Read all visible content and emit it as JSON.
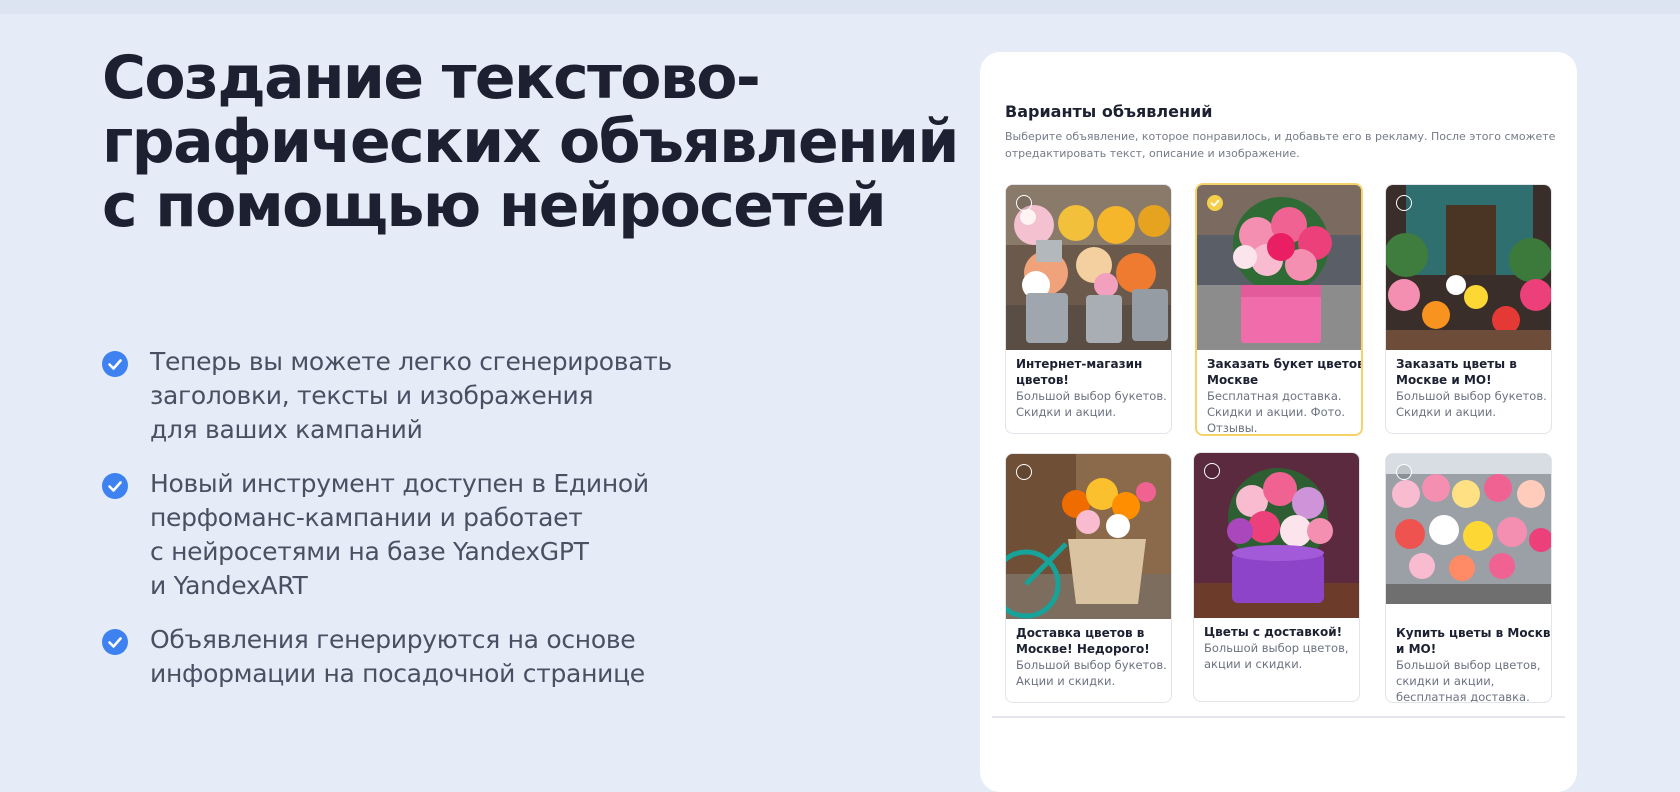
{
  "headline": {
    "lines": [
      "Создание текстово-",
      "графических объявлений",
      "с помощью нейросетей"
    ]
  },
  "bullets": [
    {
      "icon": "check-circle-icon",
      "lines": [
        "Теперь вы можете легко сгенерировать",
        "заголовки, тексты и изображения",
        "для ваших кампаний"
      ]
    },
    {
      "icon": "check-circle-icon",
      "lines": [
        "Новый инструмент доступен в Единой",
        "перфоманс-кампании и работает",
        "с нейросетями на базе YandexGPT",
        "и YandexART"
      ]
    },
    {
      "icon": "check-circle-icon",
      "lines": [
        "Объявления генерируются на основе",
        "информации на посадочной странице"
      ]
    }
  ],
  "panel": {
    "title": "Варианты объявлений",
    "description_lines": [
      "Выберите объявление, которое понравилось, и добавьте его в рекламу. После этого сможете",
      "отредактировать текст, описание и изображение."
    ],
    "ads": [
      {
        "selected": false,
        "image": "flower-buckets-street-image",
        "head": [
          "Интернет-магазин",
          "цветов!"
        ],
        "body": [
          "Большой выбор букетов.",
          "Скидки и акции."
        ]
      },
      {
        "selected": true,
        "image": "pink-bouquet-box-image",
        "head": [
          "Заказать букет цветов в",
          "Москве"
        ],
        "body": [
          "Бесплатная доставка.",
          "Скидки и акции. Фото.",
          "Отзывы."
        ]
      },
      {
        "selected": false,
        "image": "flower-shop-interior-image",
        "head": [
          "Заказать цветы в",
          "Москве и МО!"
        ],
        "body": [
          "Большой выбор букетов.",
          "Скидки и акции."
        ]
      },
      {
        "selected": false,
        "image": "bicycle-flower-bag-image",
        "head": [
          "Доставка цветов в",
          "Москве! Недорого!"
        ],
        "body": [
          "Большой выбор букетов.",
          "Акции и скидки."
        ]
      },
      {
        "selected": false,
        "image": "purple-hatbox-bouquet-image",
        "head": [
          "Цветы с доставкой!"
        ],
        "body": [
          "Большой выбор цветов,",
          "акции и скидки."
        ]
      },
      {
        "selected": false,
        "image": "flower-market-rows-image",
        "head": [
          "Купить цветы в Москве",
          "и МО!"
        ],
        "body": [
          "Большой выбор цветов,",
          "скидки и акции,",
          "бесплатная доставка."
        ]
      }
    ]
  },
  "colors": {
    "page_background": "#e5ebf7",
    "accent_blue": "#3d82f0",
    "selected_border": "#f6d36a",
    "title_text": "#1c2030",
    "bullet_text": "#4a5062"
  }
}
